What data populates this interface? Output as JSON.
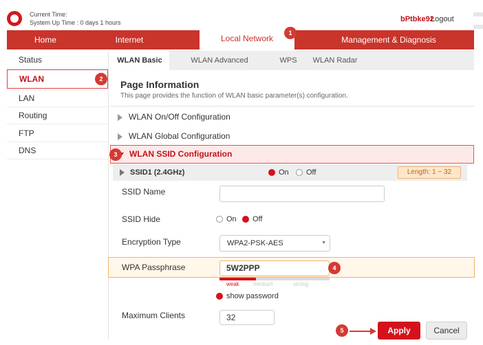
{
  "header": {
    "current_time_label": "Current Time:",
    "uptime": "System Up Time : 0 days 1 hours",
    "username": "bPtbke92",
    "logout": "Logout"
  },
  "main_nav": [
    "Home",
    "Internet",
    "Local Network",
    "Management & Diagnosis"
  ],
  "main_nav_active": "Local Network",
  "sidebar": [
    "Status",
    "WLAN",
    "LAN",
    "Routing",
    "FTP",
    "DNS"
  ],
  "sidebar_active": "WLAN",
  "sub_tabs": [
    "WLAN Basic",
    "WLAN Advanced",
    "WPS",
    "WLAN Radar"
  ],
  "sub_tab_active": "WLAN Basic",
  "page": {
    "title": "Page Information",
    "description": "This page provides the function of WLAN basic parameter(s) configuration."
  },
  "sections": [
    "WLAN On/Off Configuration",
    "WLAN Global Configuration",
    "WLAN SSID Configuration"
  ],
  "ssid": {
    "name": "SSID1 (2.4GHz)",
    "on_label": "On",
    "off_label": "Off",
    "enabled": "On",
    "length_hint": "Length: 1 ~ 32"
  },
  "form": {
    "ssid_name_label": "SSID Name",
    "ssid_name_value": "",
    "ssid_hide_label": "SSID Hide",
    "ssid_hide_on": "On",
    "ssid_hide_off": "Off",
    "ssid_hide_value": "Off",
    "encryption_label": "Encryption Type",
    "encryption_value": "WPA2-PSK-AES",
    "wpa_label": "WPA Passphrase",
    "wpa_value": "5W2PPP",
    "strength_weak": "weak",
    "strength_medium": "medium",
    "strength_strong": "strong",
    "strength_level": 0.33,
    "show_password": "show password",
    "max_clients_label": "Maximum Clients",
    "max_clients_value": "32"
  },
  "buttons": {
    "apply": "Apply",
    "cancel": "Cancel"
  },
  "step_markers": [
    "1",
    "2",
    "3",
    "4",
    "5"
  ],
  "colors": {
    "brand": "#d4121c",
    "nav": "#c9342b",
    "highlight": "#f5b26a",
    "marker": "#d43a33"
  }
}
